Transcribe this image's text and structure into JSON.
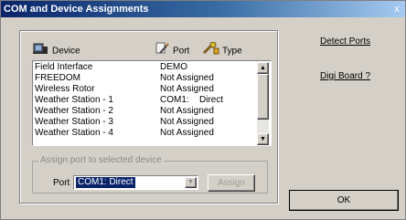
{
  "window": {
    "title": "COM and Device Assignments",
    "close_glyph": "x"
  },
  "columns": {
    "device": "Device",
    "port": "Port",
    "type": "Type"
  },
  "devices": [
    {
      "device": "Field Interface",
      "port": "DEMO",
      "type": ""
    },
    {
      "device": "FREEDOM",
      "port": "Not Assigned",
      "type": ""
    },
    {
      "device": "Wireless Rotor",
      "port": "Not Assigned",
      "type": ""
    },
    {
      "device": "Weather Station - 1",
      "port": "COM1:",
      "type": "Direct"
    },
    {
      "device": "Weather Station - 2",
      "port": "Not Assigned",
      "type": ""
    },
    {
      "device": "Weather Station - 3",
      "port": "Not Assigned",
      "type": ""
    },
    {
      "device": "Weather Station - 4",
      "port": "Not Assigned",
      "type": ""
    }
  ],
  "assign": {
    "group_label": "Assign port to selected device",
    "port_label": "Port",
    "port_value": "COM1: Direct",
    "assign_button": "Assign"
  },
  "links": {
    "detect_ports": "Detect Ports",
    "digi_board": "Digi Board ?"
  },
  "ok_button": "OK",
  "icons": {
    "device_icon": "computer-icon",
    "port_icon": "pencil-icon",
    "type_icon": "wrench-icon",
    "scroll_up": "arrow-up-icon",
    "scroll_down": "arrow-down-icon",
    "dropdown": "chevron-down-icon"
  },
  "colors": {
    "title_start": "#0a246a",
    "title_end": "#a6caf0",
    "selection": "#0a246a",
    "face": "#d4d0c8"
  }
}
